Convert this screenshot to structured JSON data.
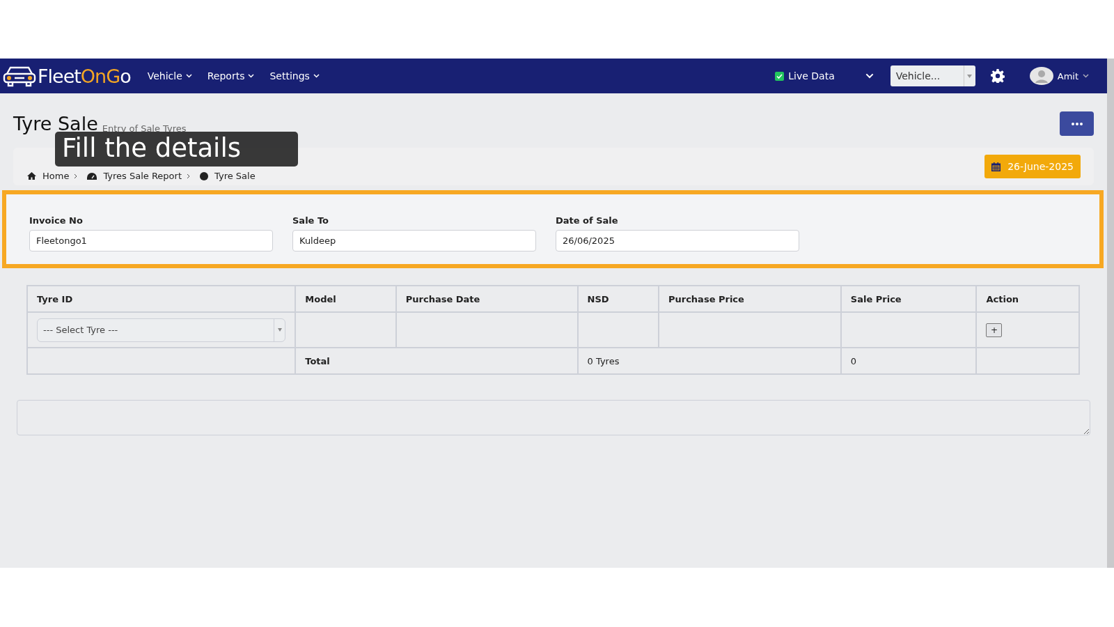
{
  "navbar": {
    "logo_parts": [
      {
        "text": "Fleet",
        "accent": false
      },
      {
        "text": "OnG",
        "accent": true
      },
      {
        "text": "o",
        "accent": false
      }
    ],
    "menu": [
      {
        "label": "Vehicle"
      },
      {
        "label": "Reports"
      },
      {
        "label": "Settings"
      }
    ],
    "live_data": {
      "label": "Live Data",
      "checked": true
    },
    "vehicle_select": {
      "placeholder": "Vehicle..."
    },
    "user": {
      "name": "Amit"
    }
  },
  "page": {
    "title": "Tyre Sale",
    "subtitle": "Entry of Sale Tyres",
    "breadcrumb": [
      {
        "label": "Home"
      },
      {
        "label": "Tyres Sale Report"
      },
      {
        "label": "Tyre Sale"
      }
    ],
    "date_badge": "26-June-2025",
    "tooltip": "Fill the details"
  },
  "form": {
    "highlighted": true,
    "fields": [
      {
        "label": "Invoice No",
        "value": "Fleetongo1"
      },
      {
        "label": "Sale To",
        "value": "Kuldeep"
      },
      {
        "label": "Date of Sale",
        "value": "26/06/2025"
      }
    ]
  },
  "table": {
    "columns": [
      "Tyre ID",
      "Model",
      "Purchase Date",
      "NSD",
      "Purchase Price",
      "Sale Price",
      "Action"
    ],
    "entry_row": {
      "tyre_select": {
        "placeholder": "--- Select Tyre ---"
      },
      "add_button": "+"
    },
    "total_row": {
      "label": "Total",
      "count": "0 Tyres",
      "sale_total": "0"
    }
  }
}
